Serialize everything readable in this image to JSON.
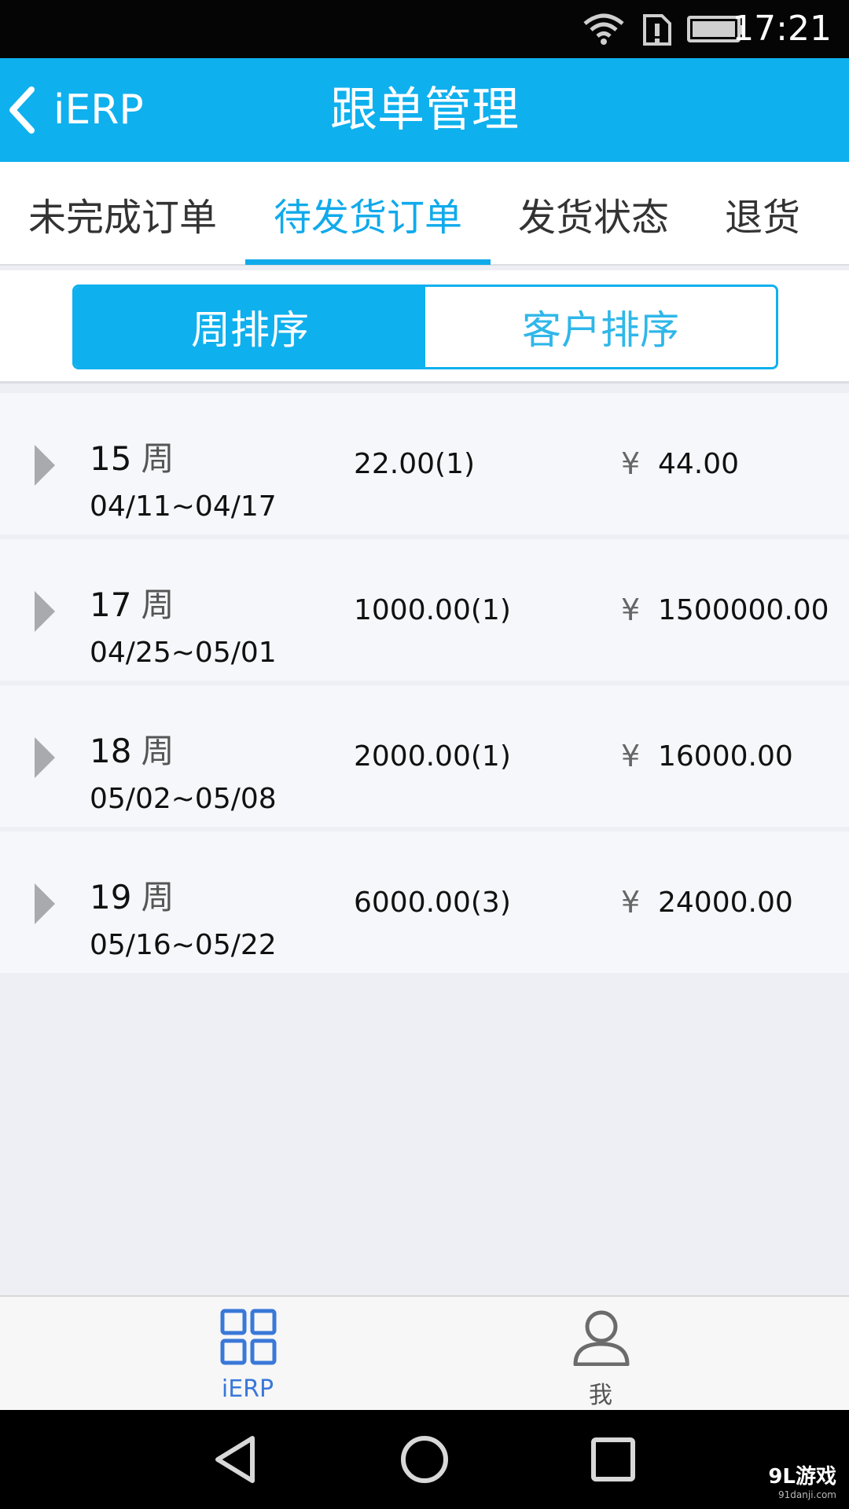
{
  "status_bar": {
    "time": "17:21"
  },
  "app_bar": {
    "back_label": "iERP",
    "title": "跟单管理"
  },
  "tabs": [
    {
      "label": "未完成订单",
      "active": false
    },
    {
      "label": "待发货订单",
      "active": true
    },
    {
      "label": "发货状态",
      "active": false
    },
    {
      "label": "退货",
      "active": false
    }
  ],
  "segmented": [
    {
      "label": "周排序",
      "active": true
    },
    {
      "label": "客户排序",
      "active": false
    }
  ],
  "rows": [
    {
      "week": "15",
      "unit": "周",
      "range": "04/11~04/17",
      "qty": "22.00(1)",
      "currency": "¥",
      "amount": "44.00"
    },
    {
      "week": "17",
      "unit": "周",
      "range": "04/25~05/01",
      "qty": "1000.00(1)",
      "currency": "¥",
      "amount": "1500000.00"
    },
    {
      "week": "18",
      "unit": "周",
      "range": "05/02~05/08",
      "qty": "2000.00(1)",
      "currency": "¥",
      "amount": "16000.00"
    },
    {
      "week": "19",
      "unit": "周",
      "range": "05/16~05/22",
      "qty": "6000.00(3)",
      "currency": "¥",
      "amount": "24000.00"
    }
  ],
  "bottom_nav": [
    {
      "label": "iERP",
      "icon": "grid-icon",
      "active": true
    },
    {
      "label": "我",
      "icon": "person-icon",
      "active": false
    }
  ],
  "watermark": {
    "brand": "9L游戏",
    "site": "91danji.com"
  },
  "colors": {
    "primary": "#0fb0ee",
    "tab_active": "#10aaeb",
    "nav_active": "#3a78d8"
  }
}
